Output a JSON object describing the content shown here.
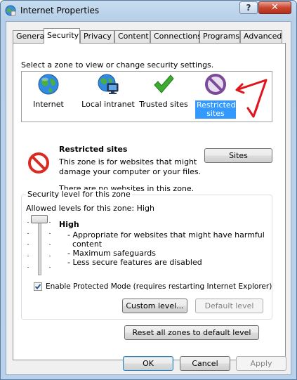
{
  "window": {
    "title": "Internet Properties",
    "close_glyph": "✕",
    "help_glyph": "?"
  },
  "tabs": [
    {
      "label": "General"
    },
    {
      "label": "Security",
      "active": true
    },
    {
      "label": "Privacy"
    },
    {
      "label": "Content"
    },
    {
      "label": "Connections"
    },
    {
      "label": "Programs"
    },
    {
      "label": "Advanced"
    }
  ],
  "security": {
    "zone_prompt": "Select a zone to view or change security settings.",
    "zones": [
      {
        "label": "Internet",
        "icon": "globe-icon"
      },
      {
        "label": "Local intranet",
        "icon": "intranet-icon"
      },
      {
        "label": "Trusted sites",
        "icon": "checkmark-icon"
      },
      {
        "label_line1": "Restricted",
        "label_line2": "sites",
        "icon": "restricted-icon",
        "selected": true
      }
    ],
    "zone_title": "Restricted sites",
    "zone_desc_line1": "This zone is for websites that might",
    "zone_desc_line2": "damage your computer or your files.",
    "zone_status": "There are no websites in this zone.",
    "sites_button": "Sites",
    "group_title": "Security level for this zone",
    "allowed_levels": "Allowed levels for this zone: High",
    "level_name": "High",
    "level_bullets": [
      "- Appropriate for websites that might have harmful",
      "  content",
      "- Maximum safeguards",
      "- Less secure features are disabled"
    ],
    "protected_mode_label": "Enable Protected Mode (requires restarting Internet Explorer)",
    "protected_mode_checked": true,
    "custom_level_button": "Custom level...",
    "default_level_button": "Default level",
    "reset_all_button": "Reset all zones to default level"
  },
  "footer": {
    "ok": "OK",
    "cancel": "Cancel",
    "apply": "Apply"
  },
  "colors": {
    "selection": "#3399ff",
    "annotation": "#e0141d"
  }
}
